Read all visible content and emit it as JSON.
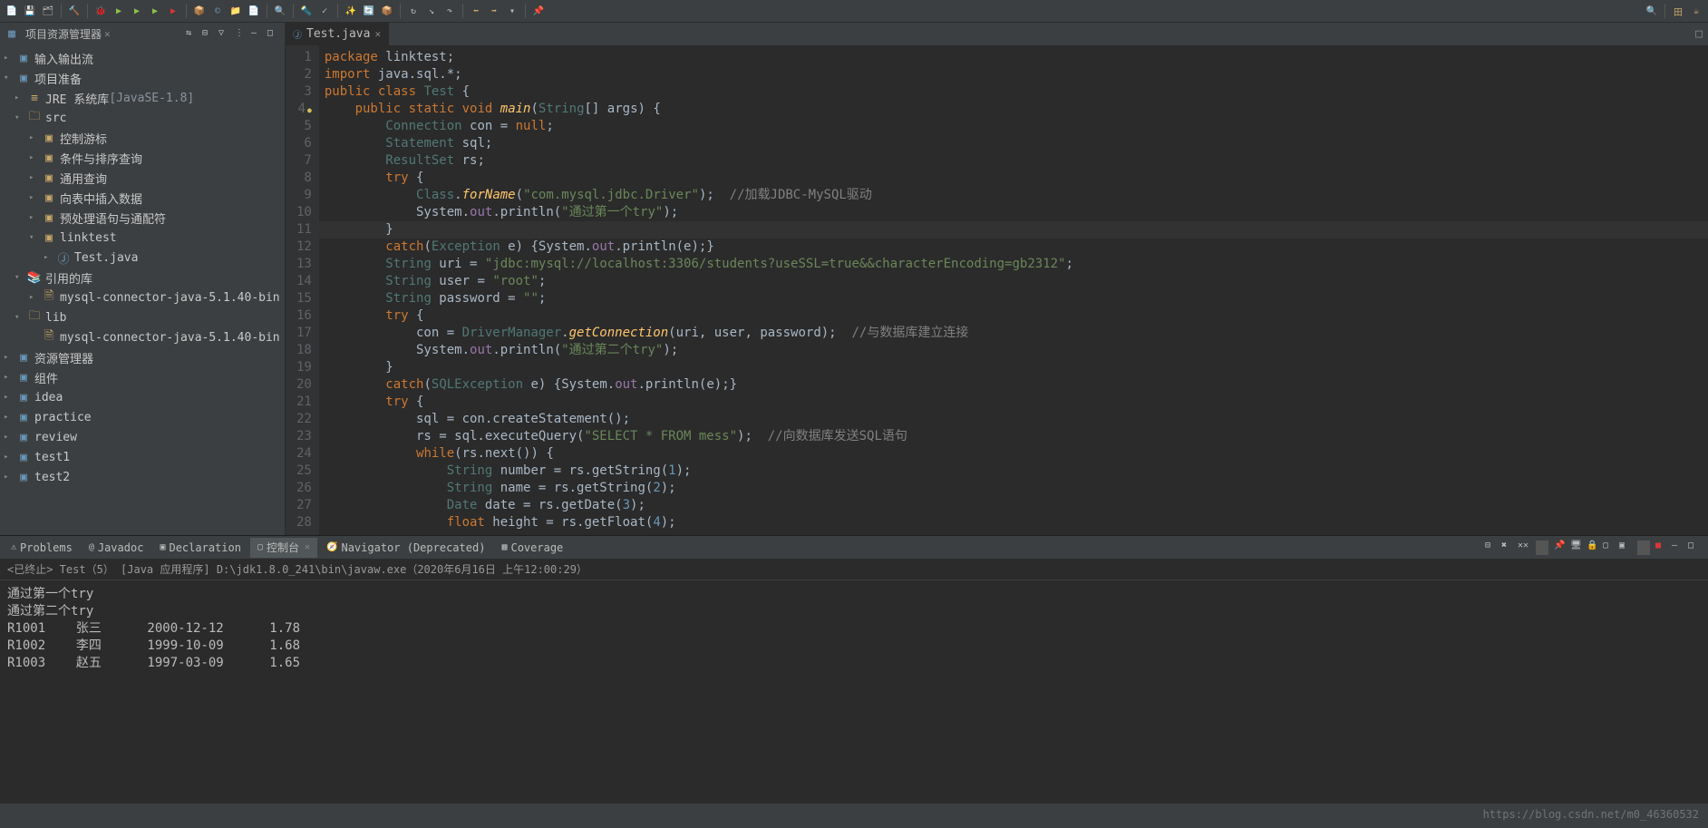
{
  "toolbar_icons": [
    "new",
    "save",
    "save-all",
    "print",
    "build",
    "debug",
    "run",
    "run-last",
    "coverage",
    "stop",
    "resume",
    "step",
    "breakpoint",
    "search",
    "package",
    "class",
    "folder",
    "file",
    "open-type",
    "task",
    "ant",
    "git",
    "pull",
    "push",
    "merge",
    "back",
    "fwd",
    "drop",
    "up",
    "perspective"
  ],
  "sidebar": {
    "title": "项目资源管理器",
    "tools": [
      "link",
      "collapse",
      "filter",
      "menu",
      "min",
      "max"
    ]
  },
  "tree": [
    {
      "ind": 0,
      "tw": "▸",
      "icon": "project",
      "label": "输入输出流"
    },
    {
      "ind": 0,
      "tw": "▾",
      "icon": "project",
      "label": "项目准备"
    },
    {
      "ind": 1,
      "tw": "▸",
      "icon": "jre",
      "label": "JRE 系统库",
      "extra": " [JavaSE-1.8]"
    },
    {
      "ind": 1,
      "tw": "▾",
      "icon": "folder",
      "label": "src"
    },
    {
      "ind": 2,
      "tw": "▸",
      "icon": "pkg",
      "label": "控制游标"
    },
    {
      "ind": 2,
      "tw": "▸",
      "icon": "pkg",
      "label": "条件与排序查询"
    },
    {
      "ind": 2,
      "tw": "▸",
      "icon": "pkg",
      "label": "通用查询"
    },
    {
      "ind": 2,
      "tw": "▸",
      "icon": "pkg",
      "label": "向表中插入数据"
    },
    {
      "ind": 2,
      "tw": "▸",
      "icon": "pkg",
      "label": "预处理语句与通配符"
    },
    {
      "ind": 2,
      "tw": "▾",
      "icon": "pkg",
      "label": "linktest"
    },
    {
      "ind": 3,
      "tw": "▸",
      "icon": "java",
      "label": "Test.java"
    },
    {
      "ind": 1,
      "tw": "▾",
      "icon": "lib",
      "label": "引用的库"
    },
    {
      "ind": 2,
      "tw": "▸",
      "icon": "jar",
      "label": "mysql-connector-java-5.1.40-bin"
    },
    {
      "ind": 1,
      "tw": "▾",
      "icon": "folder",
      "label": "lib"
    },
    {
      "ind": 2,
      "tw": "",
      "icon": "jar",
      "label": "mysql-connector-java-5.1.40-bin"
    },
    {
      "ind": 0,
      "tw": "▸",
      "icon": "project",
      "label": "资源管理器"
    },
    {
      "ind": 0,
      "tw": "▸",
      "icon": "project",
      "label": "组件"
    },
    {
      "ind": 0,
      "tw": "▸",
      "icon": "project",
      "label": "idea"
    },
    {
      "ind": 0,
      "tw": "▸",
      "icon": "project",
      "label": "practice"
    },
    {
      "ind": 0,
      "tw": "▸",
      "icon": "project",
      "label": "review"
    },
    {
      "ind": 0,
      "tw": "▸",
      "icon": "project",
      "label": "test1"
    },
    {
      "ind": 0,
      "tw": "▸",
      "icon": "project",
      "label": "test2"
    }
  ],
  "editor": {
    "tab": "Test.java",
    "lines": [
      {
        "n": 1,
        "html": "<span class='kw'>package</span> linktest;"
      },
      {
        "n": 2,
        "html": "<span class='kw'>import</span> java.sql.*;"
      },
      {
        "n": 3,
        "html": "<span class='kw'>public</span> <span class='kw'>class</span> <span class='ty'>Test</span> {"
      },
      {
        "n": 4,
        "mark": true,
        "html": "    <span class='kw'>public</span> <span class='kw'>static</span> <span class='kw'>void</span> <span class='fn'>main</span>(<span class='ty'>String</span>[] args) {"
      },
      {
        "n": 5,
        "html": "        <span class='ty'>Connection</span> con = <span class='kw'>null</span>;"
      },
      {
        "n": 6,
        "html": "        <span class='ty'>Statement</span> sql;"
      },
      {
        "n": 7,
        "html": "        <span class='ty'>ResultSet</span> rs;"
      },
      {
        "n": 8,
        "html": "        <span class='kw'>try</span> {"
      },
      {
        "n": 9,
        "html": "            <span class='ty'>Class</span>.<span class='fn'>forName</span>(<span class='st'>\"com.mysql.jdbc.Driver\"</span>);  <span class='cm'>//加载JDBC-MySQL驱动</span>"
      },
      {
        "n": 10,
        "html": "            System.<span class='fd'>out</span>.println(<span class='st'>\"通过第一个try\"</span>);"
      },
      {
        "n": 11,
        "hl": true,
        "html": "        }"
      },
      {
        "n": 12,
        "html": "        <span class='kw'>catch</span>(<span class='ty'>Exception</span> e) {System.<span class='fd'>out</span>.println(e);}"
      },
      {
        "n": 13,
        "html": "        <span class='ty'>String</span> uri = <span class='st'>\"jdbc:mysql://localhost:3306/students?useSSL=true&&characterEncoding=gb2312\"</span>;"
      },
      {
        "n": 14,
        "html": "        <span class='ty'>String</span> user = <span class='st'>\"root\"</span>;"
      },
      {
        "n": 15,
        "html": "        <span class='ty'>String</span> password = <span class='st'>\"\"</span>;"
      },
      {
        "n": 16,
        "html": "        <span class='kw'>try</span> {"
      },
      {
        "n": 17,
        "html": "            con = <span class='ty'>DriverManager</span>.<span class='fn'>getConnection</span>(uri, user, password);  <span class='cm'>//与数据库建立连接</span>"
      },
      {
        "n": 18,
        "html": "            System.<span class='fd'>out</span>.println(<span class='st'>\"通过第二个try\"</span>);"
      },
      {
        "n": 19,
        "html": "        }"
      },
      {
        "n": 20,
        "html": "        <span class='kw'>catch</span>(<span class='ty'>SQLException</span> e) {System.<span class='fd'>out</span>.println(e);}"
      },
      {
        "n": 21,
        "html": "        <span class='kw'>try</span> {"
      },
      {
        "n": 22,
        "html": "            sql = con.createStatement();"
      },
      {
        "n": 23,
        "html": "            rs = sql.executeQuery(<span class='st'>\"SELECT * FROM mess\"</span>);  <span class='cm'>//向数据库发送SQL语句</span>"
      },
      {
        "n": 24,
        "html": "            <span class='kw'>while</span>(rs.next()) {"
      },
      {
        "n": 25,
        "html": "                <span class='ty'>String</span> number = rs.getString(<span class='nm'>1</span>);"
      },
      {
        "n": 26,
        "html": "                <span class='ty'>String</span> name = rs.getString(<span class='nm'>2</span>);"
      },
      {
        "n": 27,
        "html": "                <span class='ty'>Date</span> date = rs.getDate(<span class='nm'>3</span>);"
      },
      {
        "n": 28,
        "html": "                <span class='kw'>float</span> height = rs.getFloat(<span class='nm'>4</span>);"
      }
    ]
  },
  "bottom": {
    "tabs": [
      {
        "label": "Problems",
        "active": false
      },
      {
        "label": "Javadoc",
        "active": false
      },
      {
        "label": "Declaration",
        "active": false
      },
      {
        "label": "控制台",
        "active": true,
        "close": true
      },
      {
        "label": "Navigator (Deprecated)",
        "active": false
      },
      {
        "label": "Coverage",
        "active": false
      }
    ],
    "term_line": "<已终止> Test（5） [Java 应用程序] D:\\jdk1.8.0_241\\bin\\javaw.exe（2020年6月16日 上午12:00:29）",
    "console": [
      "通过第一个try",
      "通过第二个try",
      "R1001    张三      2000-12-12      1.78",
      "R1002    李四      1999-10-09      1.68",
      "R1003    赵五      1997-03-09      1.65"
    ]
  },
  "watermark": "https://blog.csdn.net/m0_46360532"
}
